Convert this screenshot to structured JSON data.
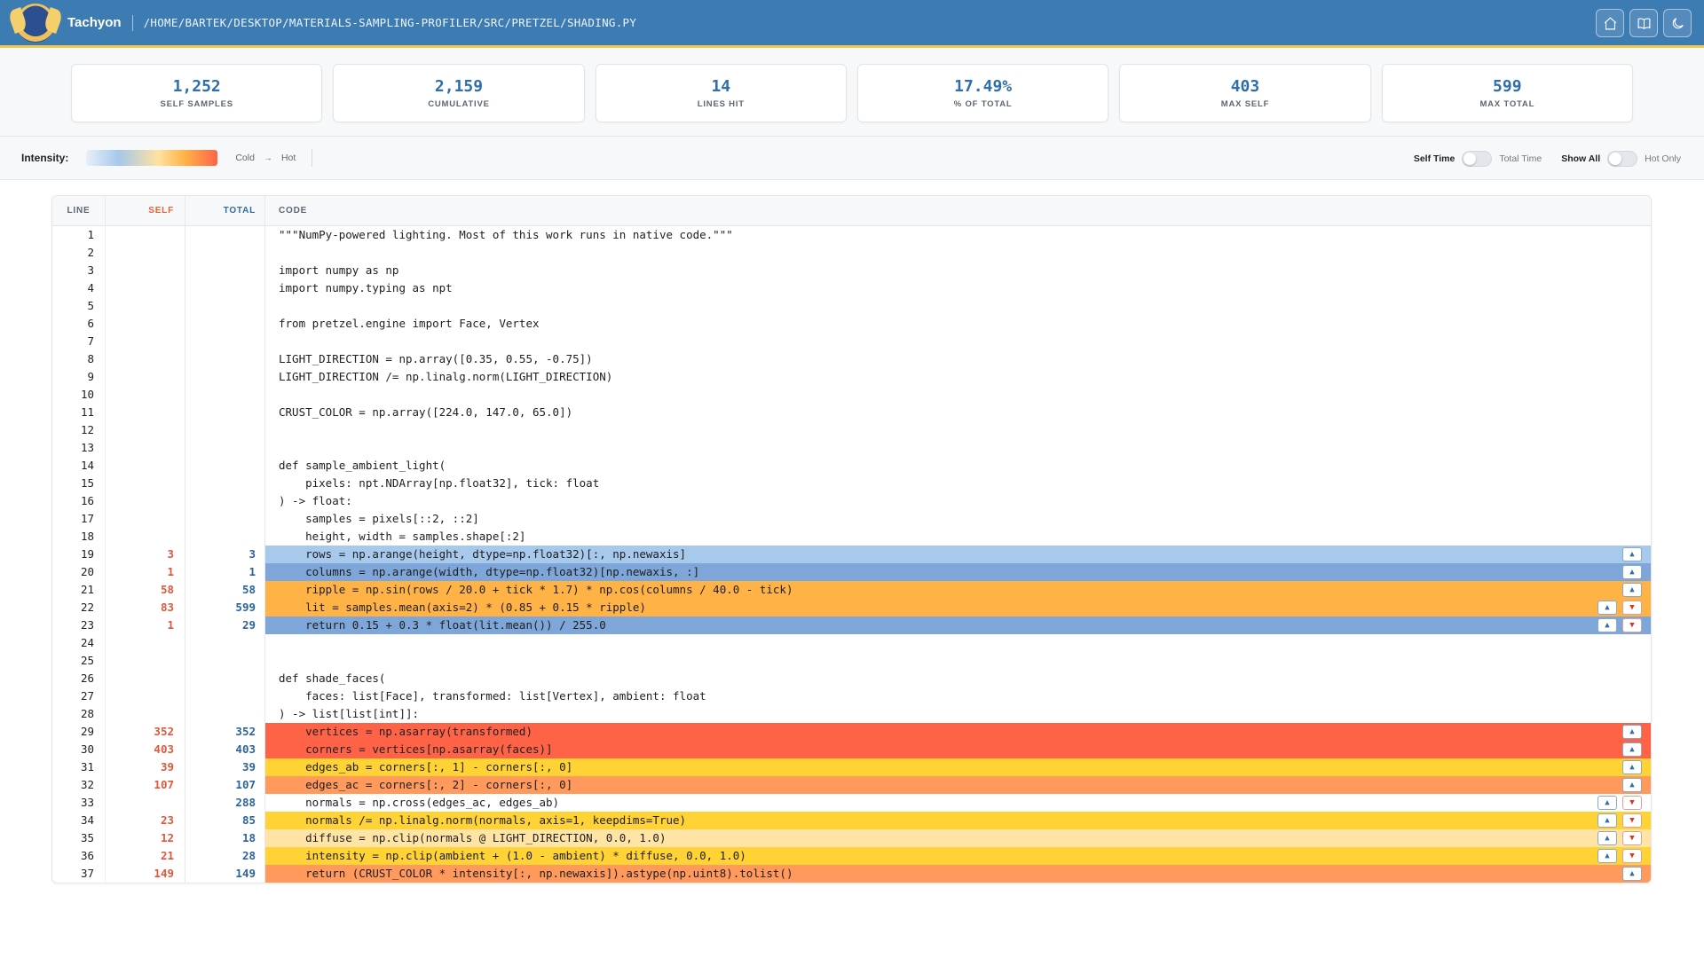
{
  "header": {
    "app_name": "Tachyon",
    "path": "/HOME/BARTEK/DESKTOP/MATERIALS-SAMPLING-PROFILER/SRC/PRETZEL/SHADING.PY",
    "buttons": [
      "home-icon",
      "book-icon",
      "moon-icon"
    ]
  },
  "stats": [
    {
      "value": "1,252",
      "label": "SELF SAMPLES"
    },
    {
      "value": "2,159",
      "label": "CUMULATIVE"
    },
    {
      "value": "14",
      "label": "LINES HIT"
    },
    {
      "value": "17.49%",
      "label": "% OF TOTAL"
    },
    {
      "value": "403",
      "label": "MAX SELF"
    },
    {
      "value": "599",
      "label": "MAX TOTAL"
    }
  ],
  "controls": {
    "intensity_label": "Intensity:",
    "cold": "Cold",
    "arrow": "→",
    "hot": "Hot",
    "toggle1_left": "Self Time",
    "toggle1_right": "Total Time",
    "toggle2_left": "Show All",
    "toggle2_right": "Hot Only"
  },
  "table": {
    "headers": {
      "line": "LINE",
      "self": "SELF",
      "total": "TOTAL",
      "code": "CODE"
    },
    "heat_colors": {
      "cold": "#a7c9ec",
      "cool": "#7ea6d8",
      "warm_light": "#ffe4a6",
      "warm": "#ffd336",
      "medium": "#ffb347",
      "hot": "#ff9a5c",
      "hottest": "#ff6347"
    },
    "rows": [
      {
        "line": "1",
        "self": "",
        "total": "",
        "code": "\"\"\"NumPy-powered lighting. Most of this work runs in native code.\"\"\"",
        "heat": "",
        "up": false,
        "down": false
      },
      {
        "line": "2",
        "self": "",
        "total": "",
        "code": "",
        "heat": "",
        "up": false,
        "down": false
      },
      {
        "line": "3",
        "self": "",
        "total": "",
        "code": "import numpy as np",
        "heat": "",
        "up": false,
        "down": false
      },
      {
        "line": "4",
        "self": "",
        "total": "",
        "code": "import numpy.typing as npt",
        "heat": "",
        "up": false,
        "down": false
      },
      {
        "line": "5",
        "self": "",
        "total": "",
        "code": "",
        "heat": "",
        "up": false,
        "down": false
      },
      {
        "line": "6",
        "self": "",
        "total": "",
        "code": "from pretzel.engine import Face, Vertex",
        "heat": "",
        "up": false,
        "down": false
      },
      {
        "line": "7",
        "self": "",
        "total": "",
        "code": "",
        "heat": "",
        "up": false,
        "down": false
      },
      {
        "line": "8",
        "self": "",
        "total": "",
        "code": "LIGHT_DIRECTION = np.array([0.35, 0.55, -0.75])",
        "heat": "",
        "up": false,
        "down": false
      },
      {
        "line": "9",
        "self": "",
        "total": "",
        "code": "LIGHT_DIRECTION /= np.linalg.norm(LIGHT_DIRECTION)",
        "heat": "",
        "up": false,
        "down": false
      },
      {
        "line": "10",
        "self": "",
        "total": "",
        "code": "",
        "heat": "",
        "up": false,
        "down": false
      },
      {
        "line": "11",
        "self": "",
        "total": "",
        "code": "CRUST_COLOR = np.array([224.0, 147.0, 65.0])",
        "heat": "",
        "up": false,
        "down": false
      },
      {
        "line": "12",
        "self": "",
        "total": "",
        "code": "",
        "heat": "",
        "up": false,
        "down": false
      },
      {
        "line": "13",
        "self": "",
        "total": "",
        "code": "",
        "heat": "",
        "up": false,
        "down": false
      },
      {
        "line": "14",
        "self": "",
        "total": "",
        "code": "def sample_ambient_light(",
        "heat": "",
        "up": false,
        "down": false
      },
      {
        "line": "15",
        "self": "",
        "total": "",
        "code": "    pixels: npt.NDArray[np.float32], tick: float",
        "heat": "",
        "up": false,
        "down": false
      },
      {
        "line": "16",
        "self": "",
        "total": "",
        "code": ") -> float:",
        "heat": "",
        "up": false,
        "down": false
      },
      {
        "line": "17",
        "self": "",
        "total": "",
        "code": "    samples = pixels[::2, ::2]",
        "heat": "",
        "up": false,
        "down": false
      },
      {
        "line": "18",
        "self": "",
        "total": "",
        "code": "    height, width = samples.shape[:2]",
        "heat": "",
        "up": false,
        "down": false
      },
      {
        "line": "19",
        "self": "3",
        "total": "3",
        "code": "    rows = np.arange(height, dtype=np.float32)[:, np.newaxis]",
        "heat": "cold",
        "up": true,
        "down": false
      },
      {
        "line": "20",
        "self": "1",
        "total": "1",
        "code": "    columns = np.arange(width, dtype=np.float32)[np.newaxis, :]",
        "heat": "cool",
        "up": true,
        "down": false
      },
      {
        "line": "21",
        "self": "58",
        "total": "58",
        "code": "    ripple = np.sin(rows / 20.0 + tick * 1.7) * np.cos(columns / 40.0 - tick)",
        "heat": "medium",
        "up": true,
        "down": false
      },
      {
        "line": "22",
        "self": "83",
        "total": "599",
        "code": "    lit = samples.mean(axis=2) * (0.85 + 0.15 * ripple)",
        "heat": "medium",
        "up": true,
        "down": true
      },
      {
        "line": "23",
        "self": "1",
        "total": "29",
        "code": "    return 0.15 + 0.3 * float(lit.mean()) / 255.0",
        "heat": "cool",
        "up": true,
        "down": true
      },
      {
        "line": "24",
        "self": "",
        "total": "",
        "code": "",
        "heat": "",
        "up": false,
        "down": false
      },
      {
        "line": "25",
        "self": "",
        "total": "",
        "code": "",
        "heat": "",
        "up": false,
        "down": false
      },
      {
        "line": "26",
        "self": "",
        "total": "",
        "code": "def shade_faces(",
        "heat": "",
        "up": false,
        "down": false
      },
      {
        "line": "27",
        "self": "",
        "total": "",
        "code": "    faces: list[Face], transformed: list[Vertex], ambient: float",
        "heat": "",
        "up": false,
        "down": false
      },
      {
        "line": "28",
        "self": "",
        "total": "",
        "code": ") -> list[list[int]]:",
        "heat": "",
        "up": false,
        "down": false
      },
      {
        "line": "29",
        "self": "352",
        "total": "352",
        "code": "    vertices = np.asarray(transformed)",
        "heat": "hottest",
        "up": true,
        "down": false
      },
      {
        "line": "30",
        "self": "403",
        "total": "403",
        "code": "    corners = vertices[np.asarray(faces)]",
        "heat": "hottest",
        "up": true,
        "down": false
      },
      {
        "line": "31",
        "self": "39",
        "total": "39",
        "code": "    edges_ab = corners[:, 1] - corners[:, 0]",
        "heat": "warm",
        "up": true,
        "down": false
      },
      {
        "line": "32",
        "self": "107",
        "total": "107",
        "code": "    edges_ac = corners[:, 2] - corners[:, 0]",
        "heat": "hot",
        "up": true,
        "down": false
      },
      {
        "line": "33",
        "self": "",
        "total": "288",
        "code": "    normals = np.cross(edges_ac, edges_ab)",
        "heat": "",
        "up": true,
        "down": true
      },
      {
        "line": "34",
        "self": "23",
        "total": "85",
        "code": "    normals /= np.linalg.norm(normals, axis=1, keepdims=True)",
        "heat": "warm",
        "up": true,
        "down": true
      },
      {
        "line": "35",
        "self": "12",
        "total": "18",
        "code": "    diffuse = np.clip(normals @ LIGHT_DIRECTION, 0.0, 1.0)",
        "heat": "warm_light",
        "up": true,
        "down": true
      },
      {
        "line": "36",
        "self": "21",
        "total": "28",
        "code": "    intensity = np.clip(ambient + (1.0 - ambient) * diffuse, 0.0, 1.0)",
        "heat": "warm",
        "up": true,
        "down": true
      },
      {
        "line": "37",
        "self": "149",
        "total": "149",
        "code": "    return (CRUST_COLOR * intensity[:, np.newaxis]).astype(np.uint8).tolist()",
        "heat": "hot",
        "up": true,
        "down": false
      }
    ]
  }
}
